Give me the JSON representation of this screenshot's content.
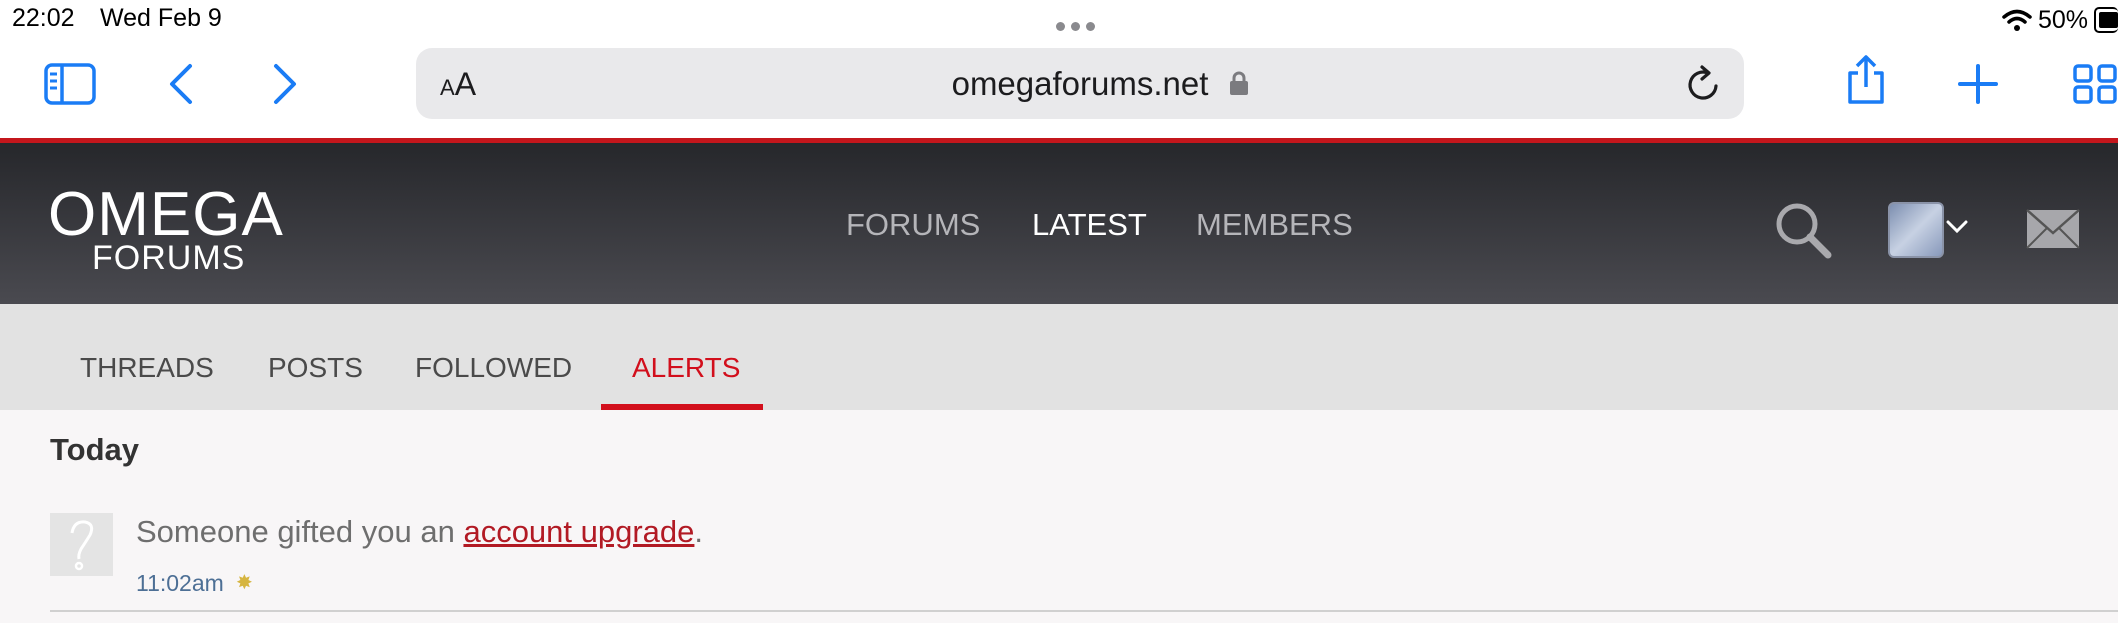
{
  "status_bar": {
    "time": "22:02",
    "date": "Wed Feb 9",
    "battery": "50%"
  },
  "browser": {
    "aa_small": "A",
    "aa_large": "A",
    "url": "omegaforums.net",
    "icons": [
      "sidebar-icon",
      "back-icon",
      "forward-icon",
      "lock-icon",
      "reload-icon",
      "share-icon",
      "new-tab-icon",
      "tabs-overview-icon"
    ]
  },
  "site_header": {
    "logo_line1": "OMEGA",
    "logo_line2": "FORUMS",
    "nav": [
      "FORUMS",
      "LATEST",
      "MEMBERS"
    ],
    "active_nav": "LATEST"
  },
  "subnav": {
    "items": [
      "THREADS",
      "POSTS",
      "FOLLOWED",
      "ALERTS"
    ],
    "active": "ALERTS"
  },
  "alerts": {
    "section_title": "Today",
    "items": [
      {
        "text_before": "Someone gifted you an ",
        "link": "account upgrade",
        "text_after": ".",
        "time": "11:02am"
      }
    ]
  },
  "colors": {
    "accent_red": "#d20f1c",
    "header_dark": "#26272b",
    "ios_blue": "#1a7cf5"
  }
}
